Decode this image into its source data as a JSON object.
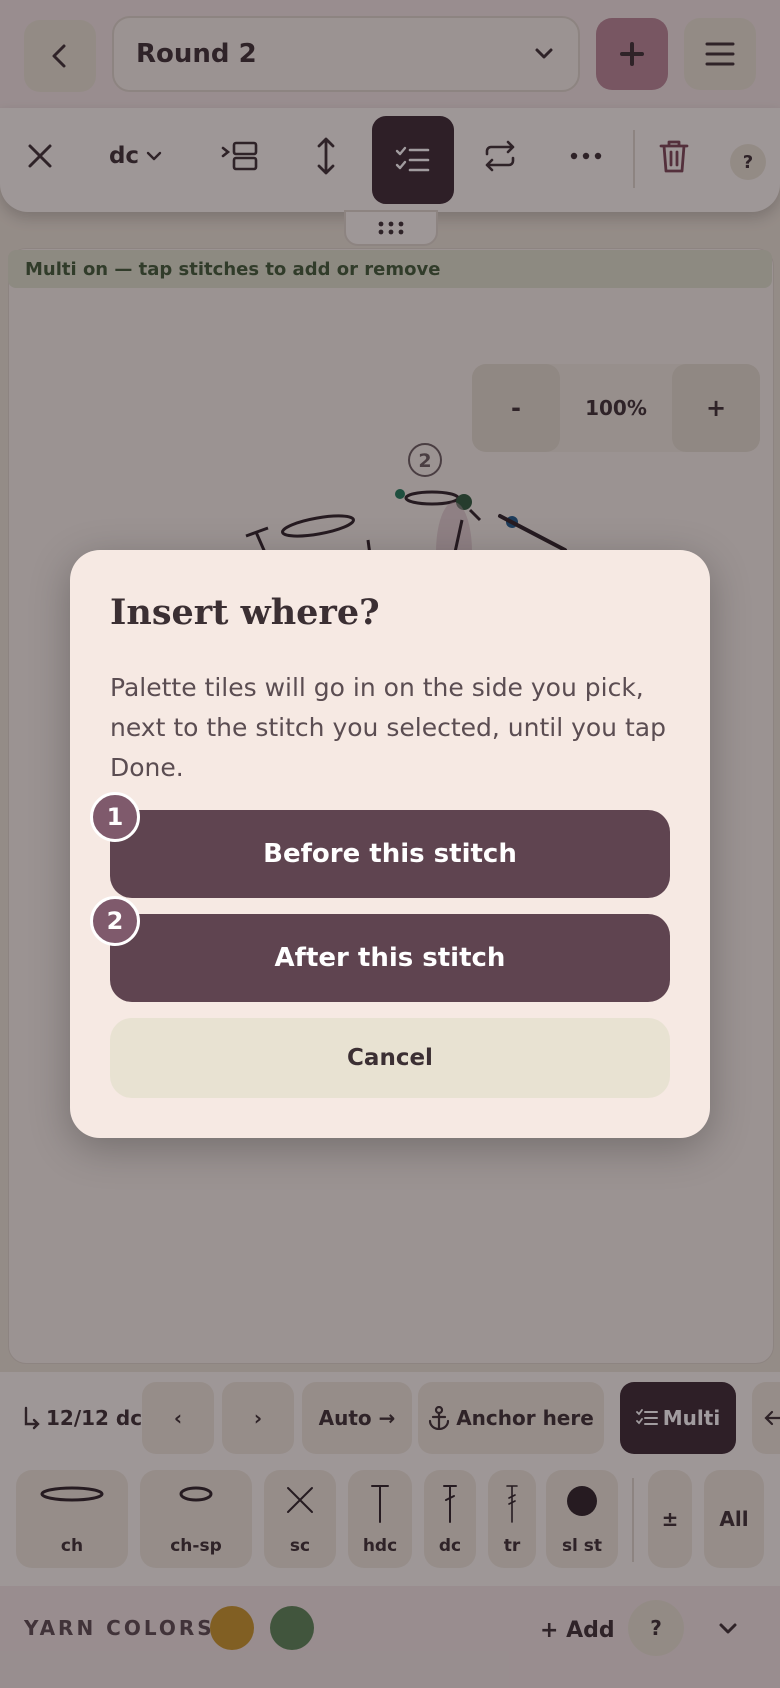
{
  "header": {
    "round_value": "Round 2",
    "colors": {
      "accent": "#b98797",
      "dark": "#3a2831"
    }
  },
  "toolbar": {
    "stitch_type": "dc",
    "active_tool": "multi-select-icon"
  },
  "status": {
    "banner": "Multi on — tap stitches to add or remove"
  },
  "zoom": {
    "minus": "-",
    "level": "100%",
    "plus": "+"
  },
  "chart_canvas": {
    "round_marker": "2"
  },
  "stitch_bar": {
    "counter": "12/12 dc",
    "prev": "‹",
    "next": "›",
    "auto": "Auto →",
    "anchor": "Anchor here",
    "multi": "Multi"
  },
  "palette": {
    "tiles": [
      {
        "label": "ch",
        "icon": "chain-oval-icon"
      },
      {
        "label": "ch-sp",
        "icon": "chain-space-icon"
      },
      {
        "label": "sc",
        "icon": "single-crochet-x-icon"
      },
      {
        "label": "hdc",
        "icon": "half-double-crochet-icon"
      },
      {
        "label": "dc",
        "icon": "double-crochet-icon"
      },
      {
        "label": "tr",
        "icon": "treble-crochet-icon"
      },
      {
        "label": "sl st",
        "icon": "slip-stitch-dot-icon"
      }
    ],
    "plusminus": "±",
    "all": "All"
  },
  "yarn": {
    "title": "YARN COLORS",
    "swatches": [
      "#c9962a",
      "#5b8556"
    ],
    "add": "+ Add",
    "help": "?"
  },
  "dialog": {
    "title": "Insert where?",
    "body": "Palette tiles will go in on the side you pick, next to the stitch you selected, until you tap Done.",
    "before_label": "Before this stitch",
    "after_label": "After this stitch",
    "cancel_label": "Cancel",
    "badge_1": "1",
    "badge_2": "2"
  }
}
